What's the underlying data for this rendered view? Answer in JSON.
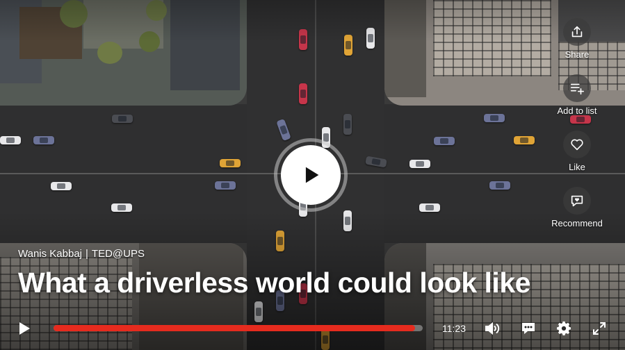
{
  "video": {
    "speaker": "Wanis Kabbaj",
    "separator": "|",
    "event": "TED@UPS",
    "title": "What a driverless world could look like"
  },
  "rail": {
    "share_label": "Share",
    "add_to_list_label": "Add to list",
    "like_label": "Like",
    "recommend_label": "Recommend"
  },
  "controls": {
    "duration": "11:23",
    "progress": 0.98,
    "accent_color": "#e62b1e"
  },
  "icons": {
    "big_play": "play-icon",
    "share": "share-icon",
    "add_to_list": "playlist-add-icon",
    "like": "heart-icon",
    "recommend": "recommend-icon",
    "play": "play-icon",
    "volume": "volume-icon",
    "captions": "captions-icon",
    "settings": "gear-icon",
    "fullscreen": "fullscreen-icon"
  }
}
